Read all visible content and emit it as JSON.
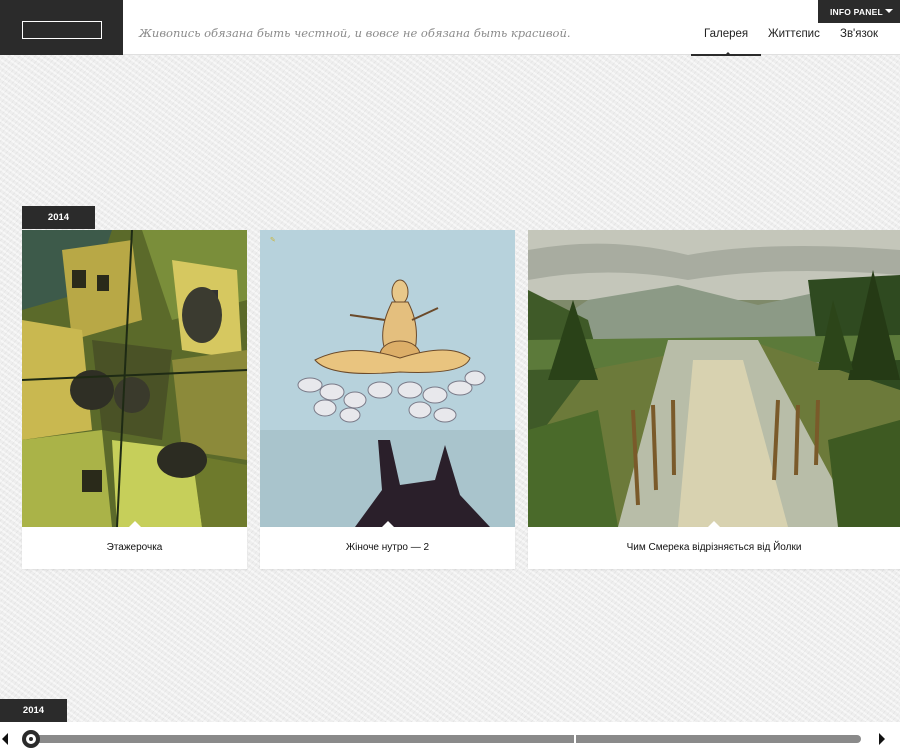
{
  "header": {
    "tagline": "Живопись обязана быть честной, и вовсе не обязана быть красивой.",
    "nav": [
      {
        "label": "Галерея",
        "active": true
      },
      {
        "label": "Життєпис",
        "active": false
      },
      {
        "label": "Зв'язок",
        "active": false
      }
    ],
    "info_panel": "INFO PANEL"
  },
  "gallery": {
    "year": "2014",
    "cards": [
      {
        "title": "Этажерочка"
      },
      {
        "title": "Жіноче нутро — 2"
      },
      {
        "title": "Чим Смерека відрізняється від Йолки"
      }
    ]
  },
  "timeline": {
    "year": "2014",
    "position": 0
  },
  "colors": {
    "dark": "#2b2b2b",
    "background": "#efefef",
    "track": "#8a8a8a"
  }
}
